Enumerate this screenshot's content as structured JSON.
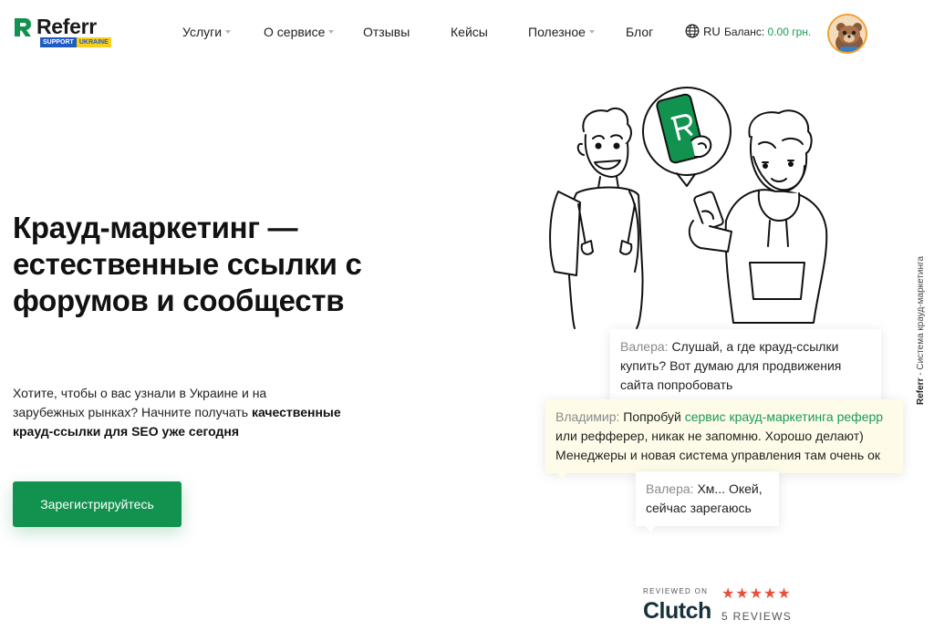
{
  "header": {
    "logo_text": "Referr",
    "logo_badge_left": "SUPPORT",
    "logo_badge_right": "UKRAINE",
    "nav": [
      {
        "label": "Услуги",
        "has_dropdown": true
      },
      {
        "label": "О сервисе",
        "has_dropdown": true
      },
      {
        "label": "Отзывы",
        "has_dropdown": false
      },
      {
        "label": "Кейсы",
        "has_dropdown": false
      },
      {
        "label": "Полезное",
        "has_dropdown": true
      },
      {
        "label": "Блог",
        "has_dropdown": false
      }
    ],
    "language": "RU",
    "balance_label": "Баланс:",
    "balance_value": "0.00 грн."
  },
  "hero": {
    "title": "Крауд-маркетинг — естественные ссылки с форумов и сообществ",
    "lead_text": "Хотите, чтобы о вас узнали в Украине и на зарубежных рынках? Начните получать",
    "lead_bold": "качественные крауд-ссылки для SEO уже сегодня",
    "cta_label": "Зарегистрируйтесь"
  },
  "chat": [
    {
      "who": "Валера:",
      "text": "Слушай, а где крауд-ссылки купить? Вот думаю для продвижения сайта попробовать"
    },
    {
      "who": "Владимир:",
      "text_before": "Попробуй",
      "link": "сервис крауд-маркетинга реферр",
      "text_after": "или рефферер, никак не запомню. Хорошо делают) Менеджеры и новая система управления там очень ок"
    },
    {
      "who": "Валера:",
      "text": "Хм... Окей, сейчас зарегаюсь"
    }
  ],
  "clutch": {
    "reviewed_on": "REVIEWED ON",
    "logo": "Clutch",
    "stars": "★★★★★",
    "rating": 5,
    "reviews": "5 REVIEWS"
  },
  "side_label": {
    "brand": "Referr",
    "text": "- Система крауд-маркетинга"
  },
  "colors": {
    "accent": "#12924f",
    "link_green": "#1a9a56",
    "badge_blue": "#1f5bc4",
    "badge_yellow": "#f7cf1c",
    "highlight_bubble": "#fefce8",
    "stars": "#e84f3d"
  },
  "icons": {
    "logo": "referr-logo-icon",
    "language": "globe-icon",
    "dropdown": "chevron-down-icon"
  }
}
